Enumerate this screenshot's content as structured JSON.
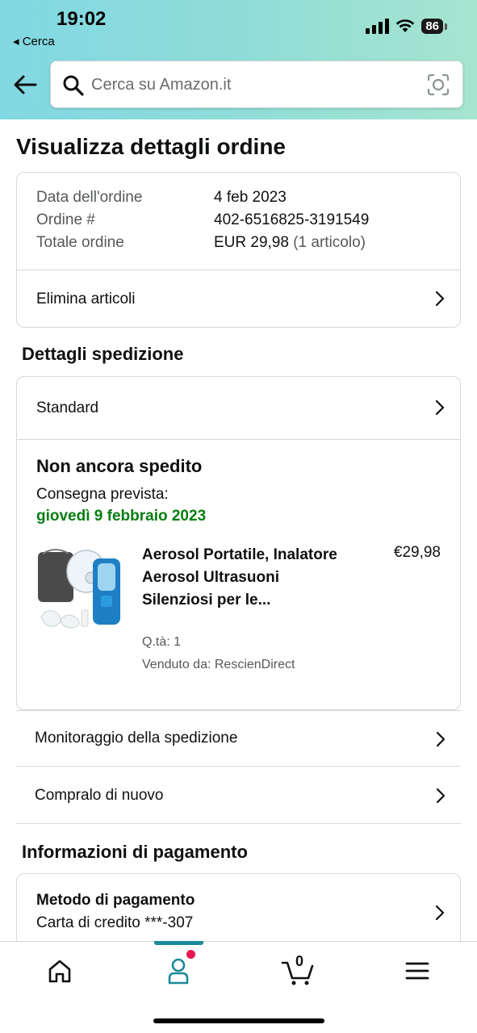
{
  "status_bar": {
    "time": "19:02",
    "back_app": "Cerca",
    "battery": "86"
  },
  "search": {
    "placeholder": "Cerca su Amazon.it"
  },
  "page_title": "Visualizza dettagli ordine",
  "order": {
    "date_label": "Data dell'ordine",
    "date_value": "4 feb 2023",
    "number_label": "Ordine #",
    "number_value": "402-6516825-3191549",
    "total_label": "Totale ordine",
    "total_value": "EUR 29,98",
    "total_count": "(1 articolo)",
    "delete_items": "Elimina articoli"
  },
  "shipping": {
    "section_title": "Dettagli spedizione",
    "method": "Standard",
    "status": "Non ancora spedito",
    "eta_label": "Consegna prevista:",
    "eta_date": "giovedì 9 febbraio 2023",
    "product": {
      "title": "Aerosol Portatile, Inalatore Aerosol Ultrasuoni Silenziosi per le...",
      "price": "€29,98",
      "qty": "Q.tà: 1",
      "seller": "Venduto da: RescienDirect"
    }
  },
  "actions": {
    "track": "Monitoraggio della spedizione",
    "buy_again": "Compralo di nuovo"
  },
  "payment": {
    "section_title": "Informazioni di pagamento",
    "method_title": "Metodo di pagamento",
    "method_detail": "Carta di credito ***-307"
  },
  "bottom_nav": {
    "cart_count": "0"
  },
  "colors": {
    "accent": "#1b8a9a",
    "delivery_green": "#067d12",
    "badge": "#e3184f"
  }
}
